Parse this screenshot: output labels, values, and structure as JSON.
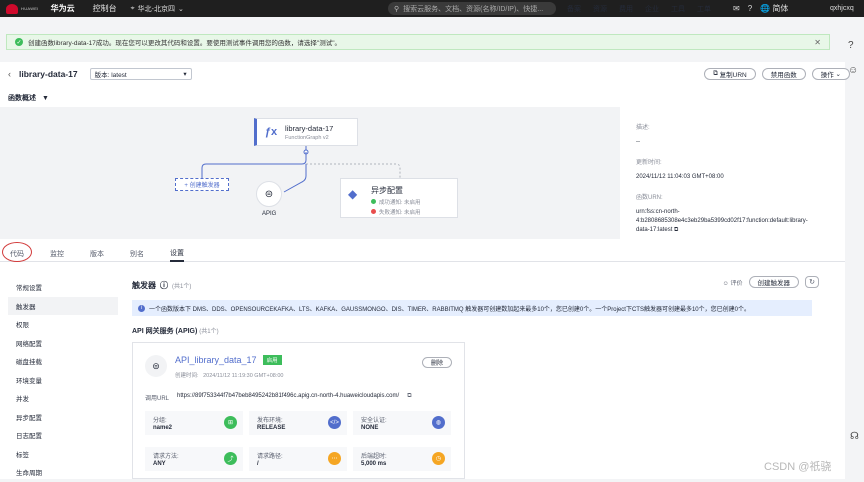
{
  "topbar": {
    "logo_text": "HUAWEI",
    "brand": "华为云",
    "console": "控制台",
    "region": "华北-北京四",
    "search_placeholder": "搜索云服务、文档、资源(名称/ID/IP)、快捷...",
    "links": [
      "备案",
      "资源",
      "费用",
      "企业",
      "工具",
      "工单"
    ],
    "lang": "简体",
    "user": "qxhjcxq"
  },
  "alert": {
    "text": "创建函数library-data-17成功。现在您可以更改其代码和设置。要使用测试事件调用您的函数，请选择\"测试\"。"
  },
  "header": {
    "title": "library-data-17",
    "version": "版本: latest",
    "copy_urn": "复制URN",
    "disable": "禁用函数",
    "ops": "操作"
  },
  "overview": {
    "label": "函数概述"
  },
  "flow": {
    "fn_name": "library-data-17",
    "fn_sub": "FunctionGraph v2",
    "add_trigger": "+ 创建触发器",
    "apig": "APIG",
    "async_title": "异步配置",
    "async_success": "成功通知: 未启用",
    "async_fail": "失败通知: 未启用"
  },
  "meta": {
    "desc_label": "描述:",
    "desc_value": "--",
    "updated_label": "更新时间:",
    "updated_value": "2024/11/12 11:04:03 GMT+08:00",
    "urn_label": "函数URN:",
    "urn_value_1": "urn:fss:cn-north-",
    "urn_value_2": "4:b2808685308e4c3eb29ba5399cd02f17:function:default:library-",
    "urn_value_3": "data-17:latest"
  },
  "tabs": [
    "代码",
    "监控",
    "版本",
    "别名",
    "设置"
  ],
  "sidenav": [
    "常规设置",
    "触发器",
    "权限",
    "网络配置",
    "磁盘挂载",
    "环境变量",
    "并发",
    "异步配置",
    "日志配置",
    "标签",
    "生命周期"
  ],
  "section": {
    "title": "触发器",
    "count": "(共1个)",
    "rate": "评价",
    "create": "创建触发器"
  },
  "info": "一个函数版本下 DMS、DDS、OPENSOURCEKAFKA、LTS、KAFKA、GAUSSMONGO、DIS、TIMER、RABBITMQ 触发器可创建数加起来最多10个，您已创建0个。一个Project下CTS触发器可创建最多10个，您已创建0个。",
  "apig_section": {
    "title": "API 网关服务 (APIG)",
    "count": "(共1个)"
  },
  "card": {
    "name": "API_library_data_17",
    "status": "启用",
    "time_label": "创建时间:",
    "time": "2024/11/12 11:19:30 GMT+08:00",
    "delete": "删除",
    "url_label": "调用URL",
    "url": "https://89f753344f7b47beb8495242b81f496c.apig.cn-north-4.huaweicloudapis.com/",
    "cells": [
      {
        "k": "分组:",
        "v": "name2",
        "c": "#3dbd5b"
      },
      {
        "k": "发布环境:",
        "v": "RELEASE",
        "c": "#526ecc"
      },
      {
        "k": "安全认证:",
        "v": "NONE",
        "c": "#526ecc"
      },
      {
        "k": "请求方法:",
        "v": "ANY",
        "c": "#3dbd5b"
      },
      {
        "k": "请求路径:",
        "v": "/",
        "c": "#f5a623"
      },
      {
        "k": "后端超时:",
        "v": "5,000 ms",
        "c": "#f5a623"
      }
    ]
  },
  "watermark": "CSDN @祇骁"
}
